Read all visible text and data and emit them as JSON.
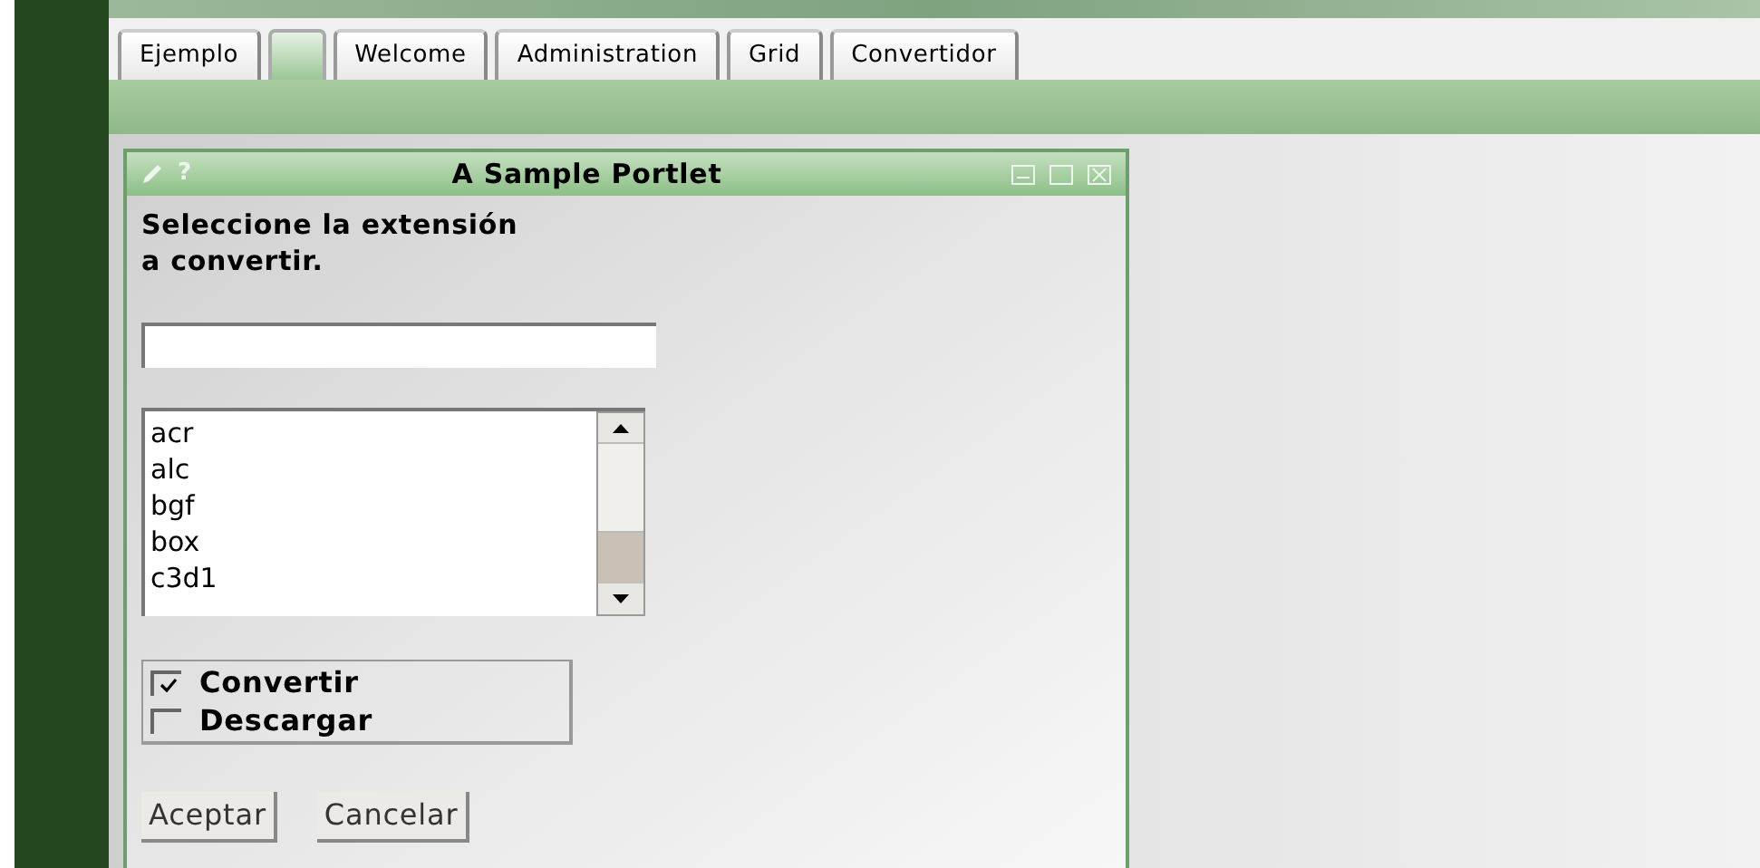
{
  "tabs": [
    {
      "label": "Ejemplo",
      "selected": false
    },
    {
      "selected": true
    },
    {
      "label": "Welcome",
      "selected": false
    },
    {
      "label": "Administration",
      "selected": false
    },
    {
      "label": "Grid",
      "selected": false
    },
    {
      "label": "Convertidor",
      "selected": false
    }
  ],
  "portlet": {
    "help": "?",
    "title": "A Sample Portlet",
    "prompt": "Seleccione la extensión\na convertir.",
    "list": [
      "acr",
      "alc",
      "bgf",
      "box",
      "c3d1"
    ],
    "options": [
      {
        "label": "Convertir",
        "checked": true
      },
      {
        "label": "Descargar",
        "checked": false
      }
    ],
    "buttons": [
      "Aceptar",
      "Cancelar"
    ]
  }
}
